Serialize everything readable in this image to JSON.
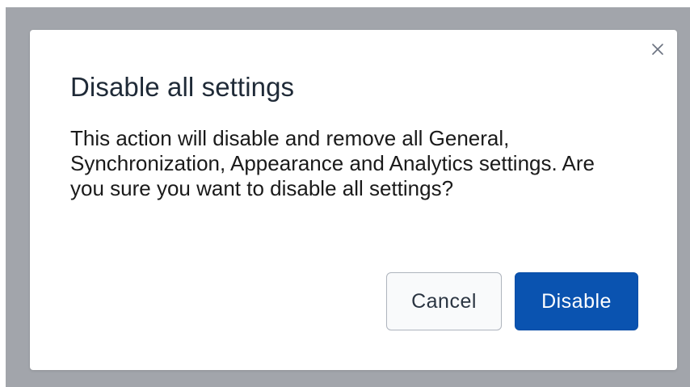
{
  "dialog": {
    "title": "Disable all settings",
    "body": "This action will disable and remove all General, Synchronization, Appearance and Analytics settings. Are you sure you want to disable all settings?",
    "close_icon": "close-icon",
    "cancel_label": "Cancel",
    "confirm_label": "Disable"
  },
  "colors": {
    "backdrop": "#a2a5ab",
    "primary": "#0a53b0",
    "title": "#1f2a37"
  }
}
